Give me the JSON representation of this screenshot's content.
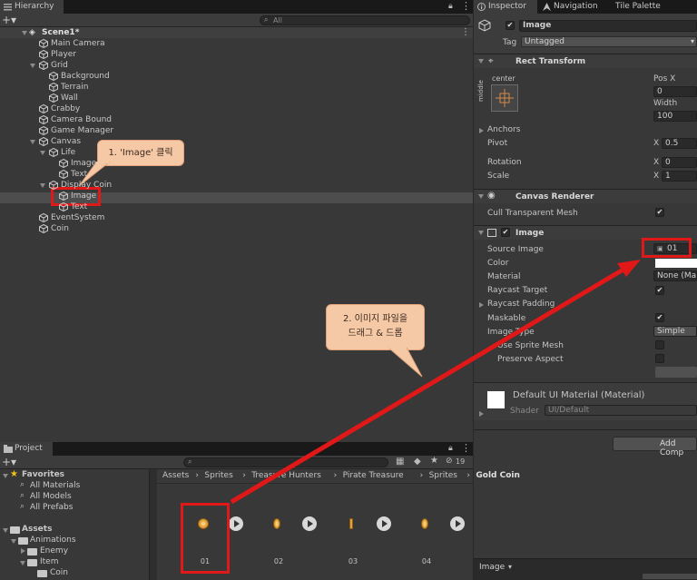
{
  "hierarchy": {
    "tab": "Hierarchy",
    "search_placeholder": "All",
    "scene": "Scene1*",
    "items": [
      {
        "label": "Main Camera"
      },
      {
        "label": "Player"
      },
      {
        "label": "Grid"
      },
      {
        "label": "Background"
      },
      {
        "label": "Terrain"
      },
      {
        "label": "Wall"
      },
      {
        "label": "Crabby"
      },
      {
        "label": "Camera Bound"
      },
      {
        "label": "Game Manager"
      },
      {
        "label": "Canvas"
      },
      {
        "label": "Life"
      },
      {
        "label": "Image"
      },
      {
        "label": "Text"
      },
      {
        "label": "Display Coin"
      },
      {
        "label": "Image"
      },
      {
        "label": "Text"
      },
      {
        "label": "EventSystem"
      },
      {
        "label": "Coin"
      }
    ]
  },
  "inspector": {
    "tabs": [
      "Inspector",
      "Navigation",
      "Tile Palette"
    ],
    "object_name": "Image",
    "tag_label": "Tag",
    "tag_value": "Untagged",
    "rect_transform": {
      "title": "Rect Transform",
      "anchor_h": "center",
      "anchor_v": "middle",
      "pos_x_label": "Pos X",
      "pos_x_value": "0",
      "width_label": "Width",
      "width_value": "100",
      "anchors_label": "Anchors",
      "pivot_label": "Pivot",
      "pivot_x_axis": "X",
      "pivot_x": "0.5",
      "rotation_label": "Rotation",
      "rotation_x_axis": "X",
      "rotation_x": "0",
      "scale_label": "Scale",
      "scale_x_axis": "X",
      "scale_x": "1"
    },
    "canvas_renderer": {
      "title": "Canvas Renderer",
      "cull_label": "Cull Transparent Mesh"
    },
    "image": {
      "title": "Image",
      "source_image_label": "Source Image",
      "source_image_value": "01",
      "color_label": "Color",
      "material_label": "Material",
      "material_value": "None (Mat",
      "raycast_target_label": "Raycast Target",
      "raycast_padding_label": "Raycast Padding",
      "maskable_label": "Maskable",
      "image_type_label": "Image Type",
      "image_type_value": "Simple",
      "use_sprite_mesh_label": "Use Sprite Mesh",
      "preserve_aspect_label": "Preserve Aspect"
    },
    "material_block": {
      "name": "Default UI Material (Material)",
      "shader_label": "Shader",
      "shader_value": "UI/Default"
    },
    "add_component": "Add Comp",
    "footer_label": "Image"
  },
  "project": {
    "tab": "Project",
    "hidden_count": "19",
    "favorites": {
      "title": "Favorites",
      "items": [
        "All Materials",
        "All Models",
        "All Prefabs"
      ]
    },
    "assets_tree": {
      "title": "Assets",
      "items": [
        "Animations",
        "Enemy",
        "Item",
        "Coin"
      ]
    },
    "breadcrumb": [
      "Assets",
      "Sprites",
      "Treasure Hunters",
      "Pirate Treasure",
      "Sprites",
      "Gold Coin"
    ],
    "assets": [
      {
        "label": "01"
      },
      {
        "label": "02"
      },
      {
        "label": "03"
      },
      {
        "label": "04"
      }
    ]
  },
  "annotations": {
    "step1": "1. 'Image' 클릭",
    "step2_line1": "2. 이미지 파일을",
    "step2_line2": "드래그 & 드롭"
  },
  "colors": {
    "annotation_red": "#e01818",
    "callout_fill": "#f6c9a6",
    "selection": "#4d4d4d",
    "coin_gold": "#e6a23c"
  }
}
